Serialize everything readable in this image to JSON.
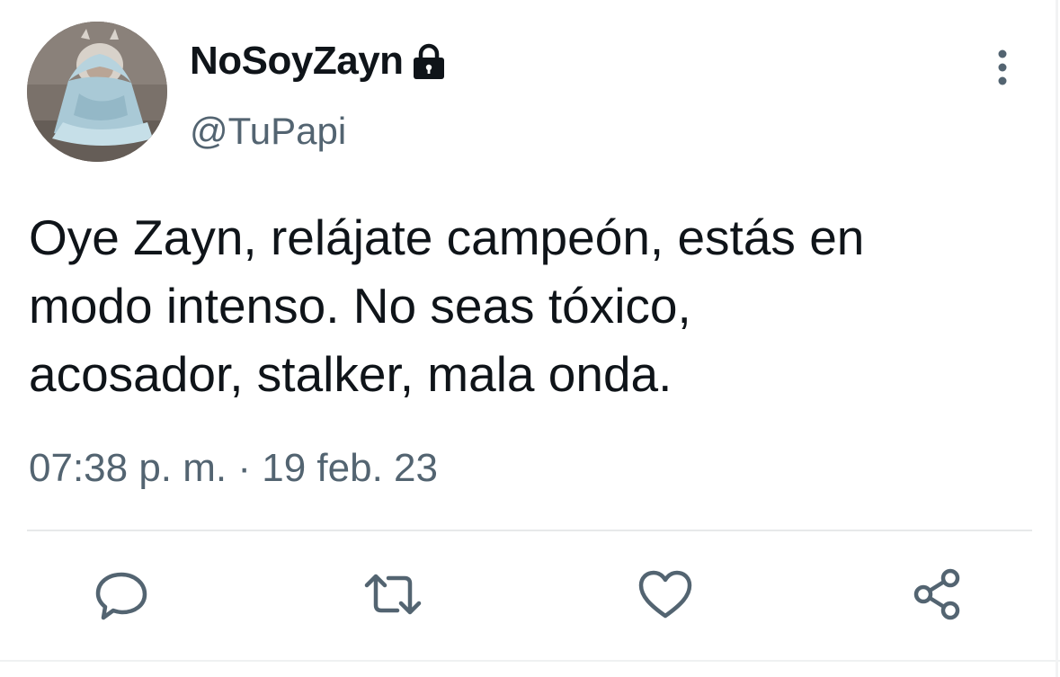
{
  "user": {
    "display_name": "NoSoyZayn",
    "username": "@TuPapi",
    "protected": true
  },
  "tweet": {
    "text_lines": [
      "Oye Zayn, relájate campeón, estás en",
      "modo intenso. No seas tóxico,",
      "acosador, stalker, mala onda."
    ],
    "time": "07:38 p. m.",
    "separator": "·",
    "date": "19 feb. 23"
  },
  "actions": [
    "reply-icon",
    "retweet-icon",
    "like-icon",
    "share-icon"
  ],
  "colors": {
    "primary_text": "#0f1419",
    "secondary_text": "#536471",
    "icon": "#536471",
    "divider": "#e7e9ea",
    "background": "#ffffff"
  }
}
